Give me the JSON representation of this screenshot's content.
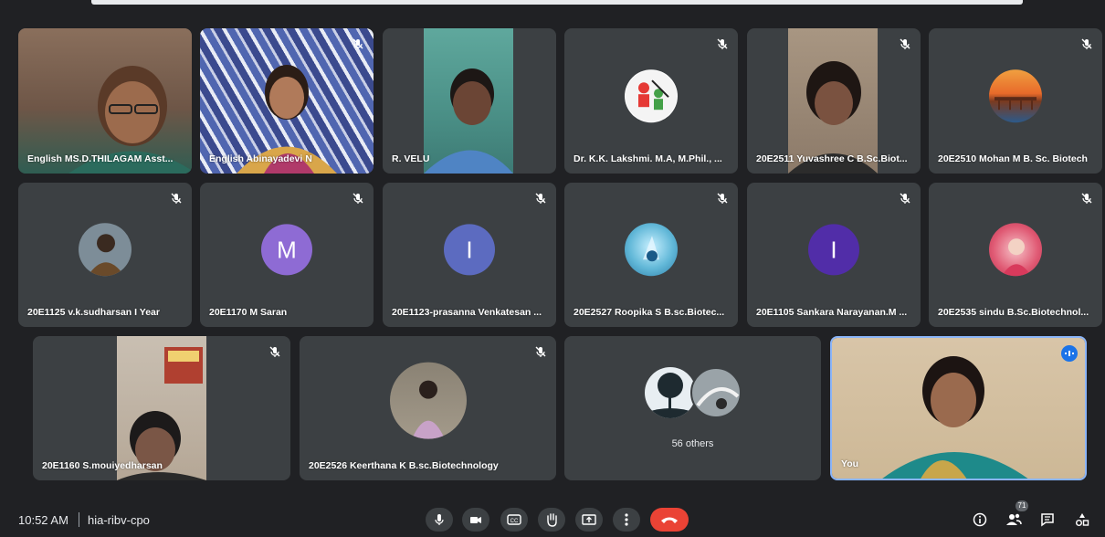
{
  "participants": {
    "t1": "English MS.D.THILAGAM Asst...",
    "t2": "English Abinayadevi N",
    "t3": "R. VELU",
    "t4": "Dr. K.K. Lakshmi. M.A, M.Phil., ...",
    "t5": "20E2511 Yuvashree C B.Sc.Biot...",
    "t6": "20E2510 Mohan M B. Sc. Biotech",
    "t7": "20E1125 v.k.sudharsan I Year",
    "t8": "20E1170 M Saran",
    "t9": "20E1123-prasanna Venkatesan ...",
    "t10": "20E2527 Roopika S B.sc.Biotec...",
    "t11": "20E1105 Sankara Narayanan.M ...",
    "t12": "20E2535 sindu B.Sc.Biotechnol...",
    "t13": "20E1160 S.mouiyedharsan",
    "t14": "20E2526 Keerthana K B.sc.Biotechnology",
    "others": "56 others",
    "self": "You"
  },
  "avatars": {
    "t8": "M",
    "t9": "I",
    "t11": "I"
  },
  "avatar_colors": {
    "t8": "#8e6bd4",
    "t9": "#5c6bc0",
    "t11": "#512da8"
  },
  "footer": {
    "time": "10:52 AM",
    "meeting_code": "hia-ribv-cpo",
    "people_count": "71"
  },
  "colors": {
    "background": "#202124",
    "tile": "#3c4043",
    "end_call": "#ea4335",
    "accent": "#1a73e8"
  },
  "icons": [
    "mic-off-icon",
    "mic-icon",
    "camera-icon",
    "captions-icon",
    "raise-hand-icon",
    "present-icon",
    "more-icon",
    "end-call-icon",
    "info-icon",
    "people-icon",
    "chat-icon",
    "activities-icon",
    "speaking-indicator-icon"
  ]
}
